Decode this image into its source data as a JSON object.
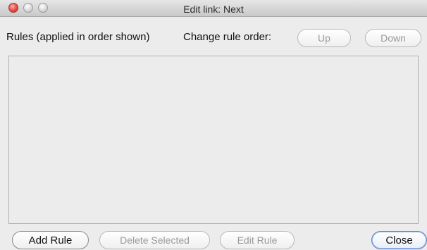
{
  "window": {
    "title": "Edit link: Next"
  },
  "header": {
    "rules_label": "Rules (applied in order shown)",
    "change_order_label": "Change rule order:",
    "up_label": "Up",
    "down_label": "Down"
  },
  "rules": {
    "items": []
  },
  "footer": {
    "add_rule_label": "Add Rule",
    "delete_selected_label": "Delete Selected",
    "edit_rule_label": "Edit Rule",
    "close_label": "Close"
  },
  "colors": {
    "window_background": "#ececec",
    "close_light": "#ec5a54",
    "default_button_border": "#5f87c8"
  }
}
